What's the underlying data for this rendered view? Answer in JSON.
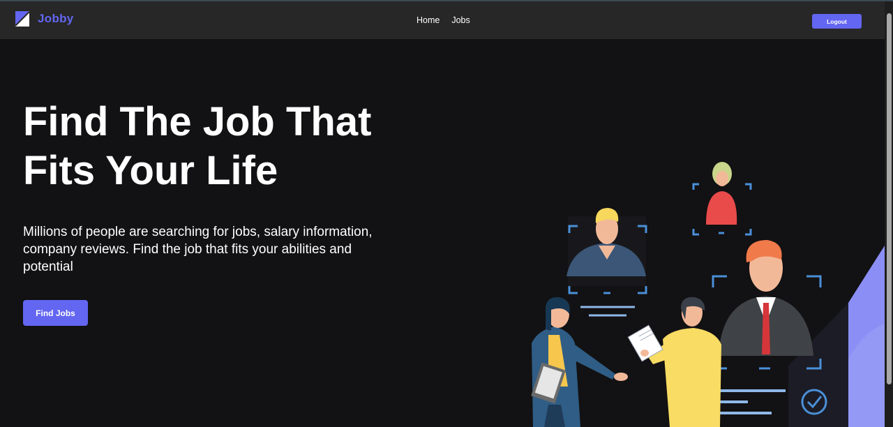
{
  "navbar": {
    "brand": "Jobby",
    "logo_icon": "jobby-logo-icon",
    "links": [
      "Home",
      "Jobs"
    ],
    "logout_label": "Logout"
  },
  "hero": {
    "title_line1": "Find The Job That",
    "title_line2": "Fits Your Life",
    "description": "Millions of people are searching for jobs, salary information, company reviews. Find the job that fits your abilities and potential",
    "cta_label": "Find Jobs"
  },
  "colors": {
    "accent": "#6366f1",
    "navbar_bg": "#272727",
    "page_bg": "#121113",
    "text": "#ffffff"
  }
}
